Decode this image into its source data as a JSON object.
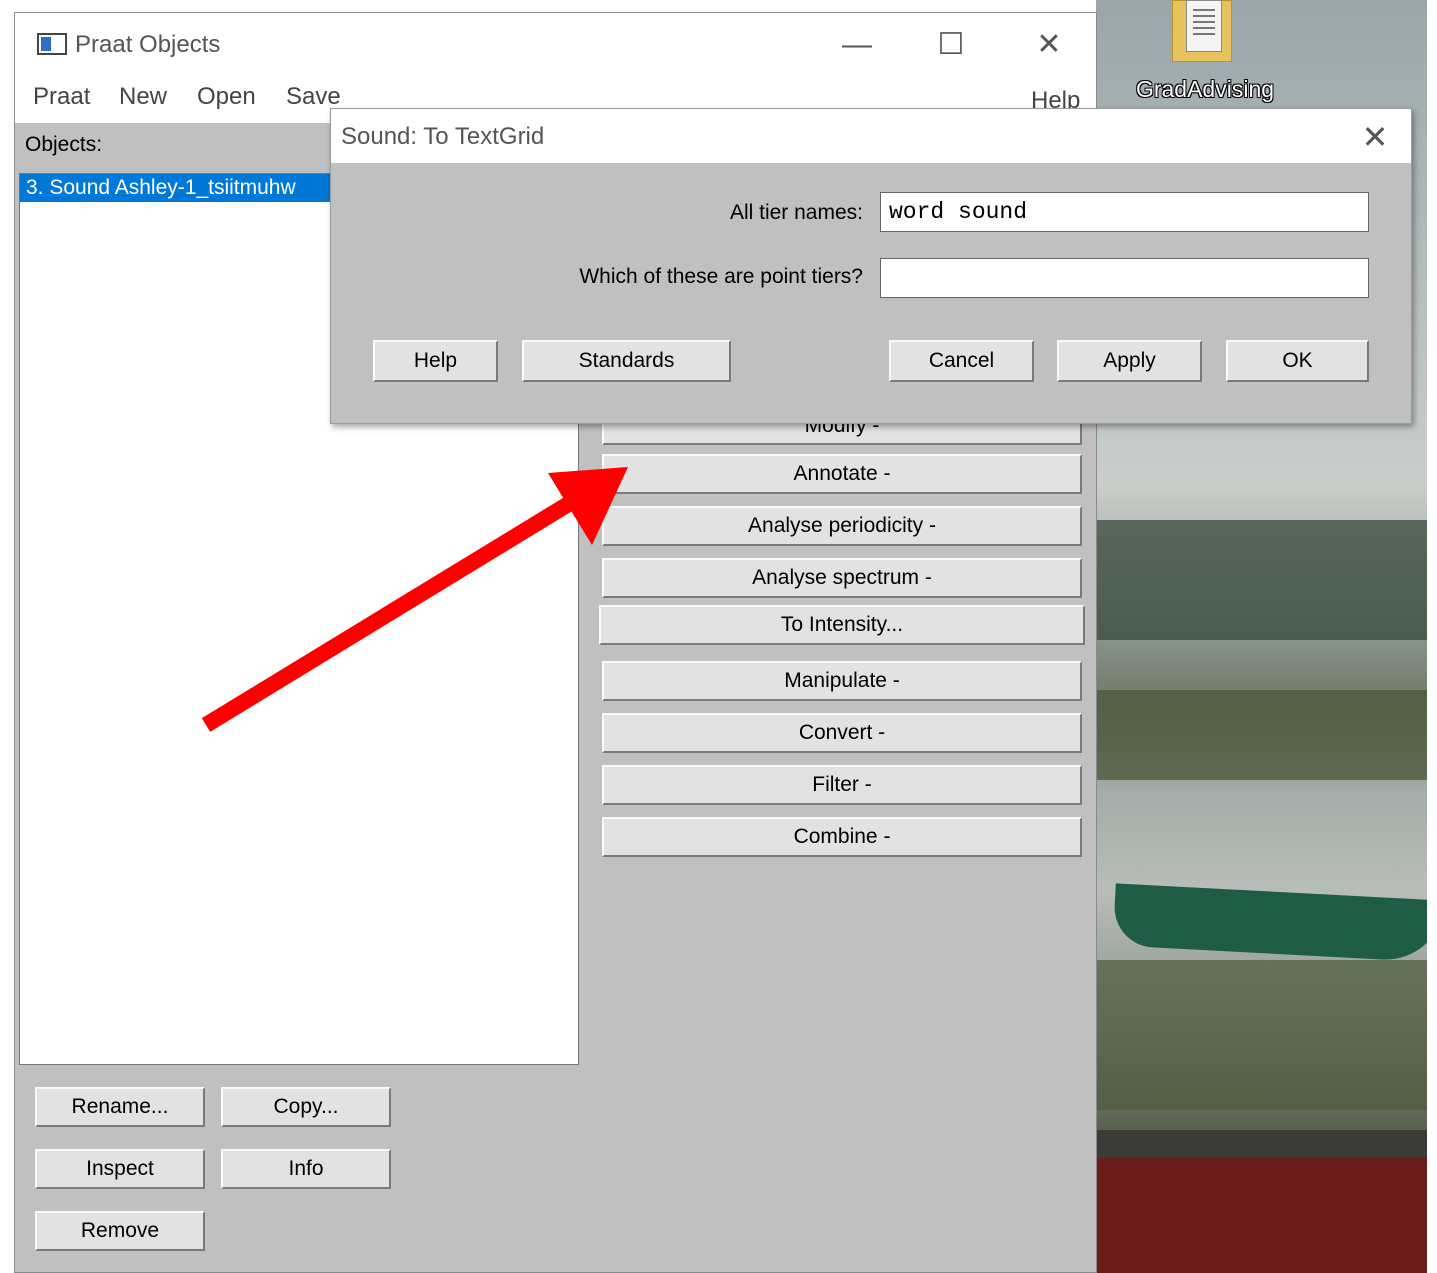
{
  "desktop": {
    "icon_label": "GradAdvising"
  },
  "window": {
    "title": "Praat Objects",
    "controls": {
      "minimize": "—",
      "maximize": "☐",
      "close": "✕"
    },
    "menu": [
      "Praat",
      "New",
      "Open",
      "Save"
    ],
    "menu_help": "Help",
    "objects_label": "Objects:",
    "objects": [
      "3. Sound Ashley-1_tsiitmuhw"
    ],
    "action_buttons": [
      "Modify -",
      "Annotate -",
      "Analyse periodicity -",
      "Analyse spectrum -",
      "To Intensity...",
      "Manipulate -",
      "Convert -",
      "Filter -",
      "Combine -"
    ],
    "bottom_buttons": {
      "rename": "Rename...",
      "copy": "Copy...",
      "inspect": "Inspect",
      "info": "Info",
      "remove": "Remove"
    }
  },
  "dialog": {
    "title": "Sound: To TextGrid",
    "close": "✕",
    "fields": {
      "tier_names_label": "All tier names:",
      "tier_names_value": "word sound",
      "point_tiers_label": "Which of these are point tiers?",
      "point_tiers_value": ""
    },
    "buttons": {
      "help": "Help",
      "standards": "Standards",
      "cancel": "Cancel",
      "apply": "Apply",
      "ok": "OK"
    }
  },
  "annotation": {
    "arrow_color": "#ff0000"
  }
}
